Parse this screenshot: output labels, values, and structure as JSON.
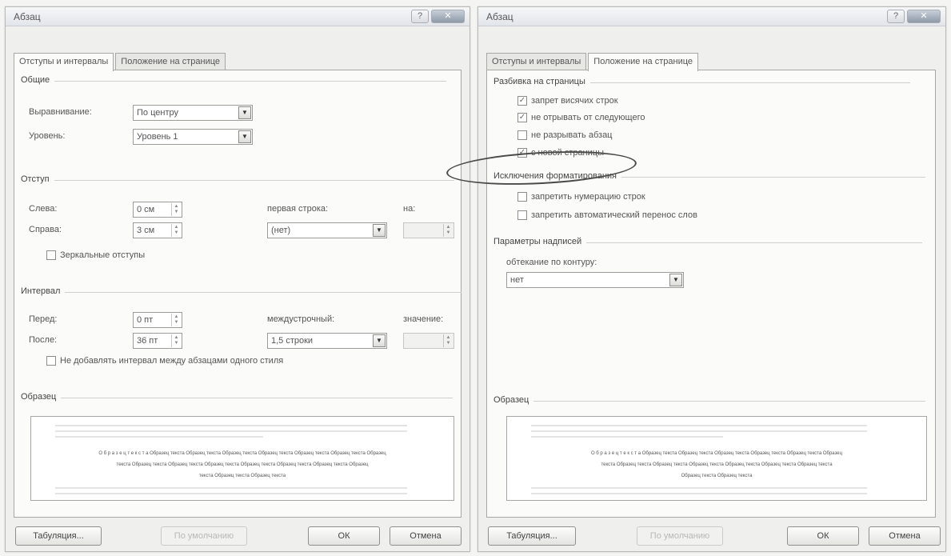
{
  "left": {
    "title": "Абзац",
    "tabs": [
      "Отступы и интервалы",
      "Положение на странице"
    ],
    "general": {
      "title": "Общие",
      "align_label": "Выравнивание:",
      "align_value": "По центру",
      "level_label": "Уровень:",
      "level_value": "Уровень 1"
    },
    "indent": {
      "title": "Отступ",
      "left_label": "Слева:",
      "left_value": "0 см",
      "right_label": "Справа:",
      "right_value": "3 см",
      "first_label": "первая строка:",
      "first_value": "(нет)",
      "on_label": "на:",
      "mirror_label": "Зеркальные отступы"
    },
    "spacing": {
      "title": "Интервал",
      "before_label": "Перед:",
      "before_value": "0 пт",
      "after_label": "После:",
      "after_value": "36 пт",
      "line_label": "междустрочный:",
      "line_value": "1,5 строки",
      "value_label": "значение:",
      "no_space_label": "Не добавлять интервал между абзацами одного стиля"
    },
    "preview": {
      "title": "Образец",
      "sample_lines": [
        "О б р а з е ц  т е к с т а Образец текста Образец текста Образец текста Образец текста Образец текста Образец текста Образец",
        "текста Образец текста Образец текста Образец текста Образец текста Образец текста Образец текста Образец",
        "текста Образец текста Образец текста"
      ]
    },
    "buttons": {
      "tabs": "Табуляция...",
      "default": "По умолчанию",
      "ok": "ОК",
      "cancel": "Отмена"
    }
  },
  "right": {
    "title": "Абзац",
    "tabs": [
      "Отступы и интервалы",
      "Положение на странице"
    ],
    "pagination": {
      "title": "Разбивка на страницы",
      "items": [
        {
          "label": "запрет висячих строк",
          "checked": true
        },
        {
          "label": "не отрывать от следующего",
          "checked": true
        },
        {
          "label": "не разрывать абзац",
          "checked": false
        },
        {
          "label": "с новой страницы",
          "checked": true
        }
      ]
    },
    "exceptions": {
      "title": "Исключения форматирования",
      "items": [
        {
          "label": "запретить нумерацию строк",
          "checked": false
        },
        {
          "label": "запретить автоматический перенос слов",
          "checked": false
        }
      ]
    },
    "textbox": {
      "title": "Параметры надписей",
      "wrap_label": "обтекание по контуру:",
      "wrap_value": "нет"
    },
    "preview": {
      "title": "Образец",
      "sample_lines": [
        "О б р а з е ц  т е к с т а Образец текста Образец текста Образец текста Образец текста Образец текста Образец",
        "текста Образец текста Образец текста Образец текста Образец текста Образец текста Образец текста",
        "Образец текста Образец текста"
      ]
    },
    "buttons": {
      "tabs": "Табуляция...",
      "default": "По умолчанию",
      "ok": "ОК",
      "cancel": "Отмена"
    }
  },
  "checkmark": "✓",
  "arrow_glyph": "▼"
}
